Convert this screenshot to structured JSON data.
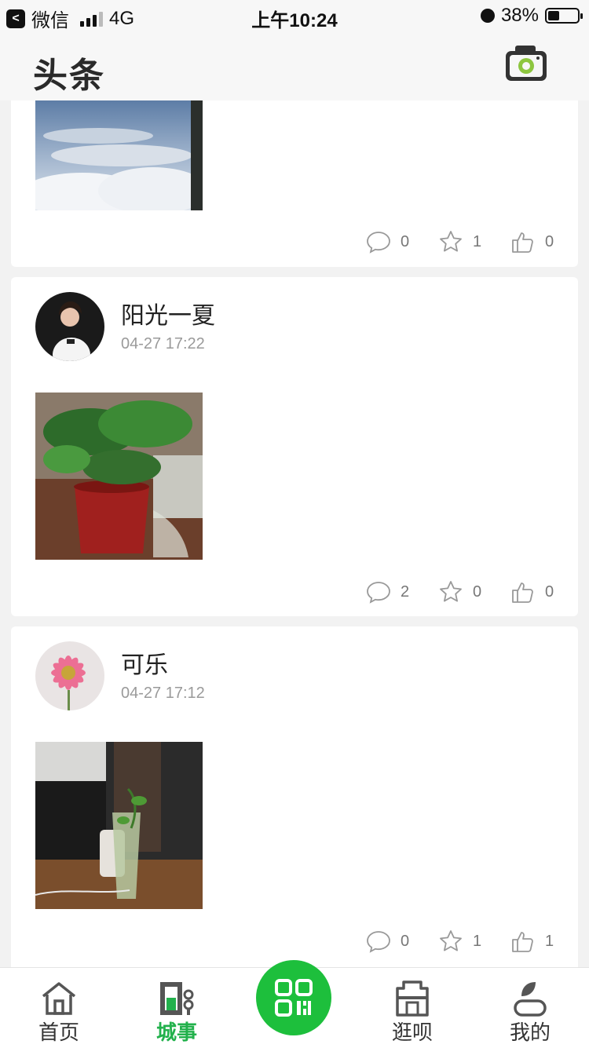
{
  "status_bar": {
    "back_app": "微信",
    "network": "4G",
    "time": "上午10:24",
    "battery": "38%",
    "battery_level": 0.38
  },
  "header": {
    "title": "头条",
    "camera_icon": "camera-icon"
  },
  "posts": [
    {
      "author": "",
      "time": "",
      "photo": "airplane-window-clouds",
      "comments": "0",
      "favorites": "1",
      "likes": "0"
    },
    {
      "author": "阳光一夏",
      "time": "04-27 17:22",
      "avatar": "girl-avatar",
      "photo": "potted-plant",
      "comments": "2",
      "favorites": "0",
      "likes": "0"
    },
    {
      "author": "可乐",
      "time": "04-27 17:12",
      "avatar": "flower-avatar",
      "photo": "plant-in-vase",
      "comments": "0",
      "favorites": "1",
      "likes": "1"
    }
  ],
  "tabbar": {
    "items": [
      {
        "label": "首页",
        "icon": "home-icon"
      },
      {
        "label": "城事",
        "icon": "city-icon",
        "active": true
      },
      {
        "label": "",
        "icon": "qr-scan-icon"
      },
      {
        "label": "逛呗",
        "icon": "shop-icon"
      },
      {
        "label": "我的",
        "icon": "profile-icon"
      }
    ]
  },
  "colors": {
    "accent_green": "#22b14c",
    "scan_green": "#1dbf3c",
    "camera_green": "#8dc63f"
  }
}
